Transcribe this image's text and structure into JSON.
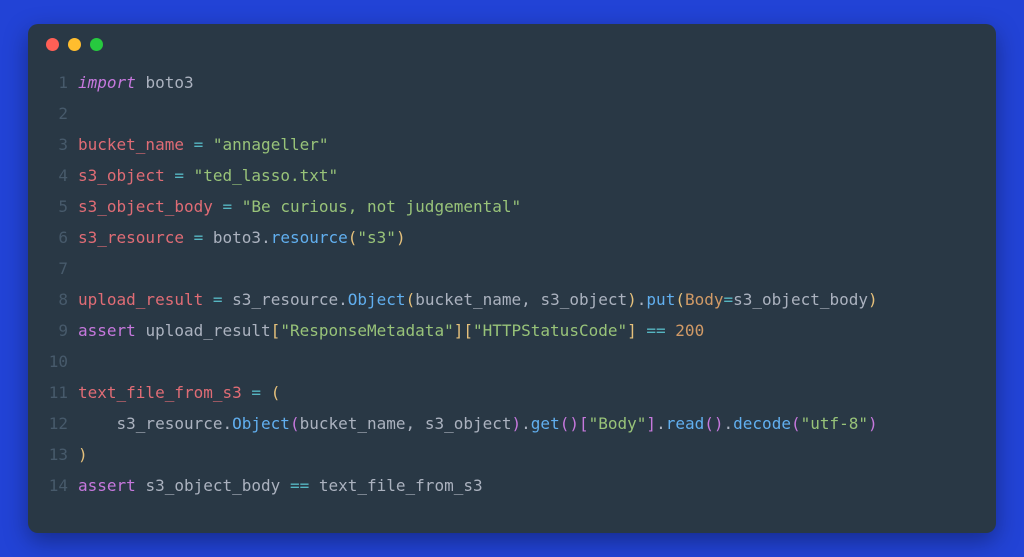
{
  "window": {
    "traffic_lights": [
      "red",
      "yellow",
      "green"
    ]
  },
  "code": {
    "line_count": 14,
    "tokens": {
      "kw_import": "import",
      "kw_assert": "assert",
      "mod_boto3": "boto3",
      "var_bucket_name": "bucket_name",
      "var_s3_object": "s3_object",
      "var_s3_object_body": "s3_object_body",
      "var_s3_resource": "s3_resource",
      "var_upload_result": "upload_result",
      "var_text_file_from_s3": "text_file_from_s3",
      "str_annageller": "\"annageller\"",
      "str_ted_lasso": "\"ted_lasso.txt\"",
      "str_body_text": "\"Be curious, not judgemental\"",
      "str_s3": "\"s3\"",
      "str_response_metadata": "\"ResponseMetadata\"",
      "str_http_status_code": "\"HTTPStatusCode\"",
      "str_body_key": "\"Body\"",
      "str_utf8": "\"utf-8\"",
      "fn_resource": "resource",
      "fn_object": "Object",
      "fn_put": "put",
      "fn_get": "get",
      "fn_read": "read",
      "fn_decode": "decode",
      "kwarg_body": "Body",
      "num_200": "200",
      "op_eq": "=",
      "op_deq": "=="
    },
    "ln": {
      "1": "1",
      "2": "2",
      "3": "3",
      "4": "4",
      "5": "5",
      "6": "6",
      "7": "7",
      "8": "8",
      "9": "9",
      "10": "10",
      "11": "11",
      "12": "12",
      "13": "13",
      "14": "14"
    }
  },
  "colors": {
    "page_bg": "#2243d6",
    "window_bg": "#293845",
    "keyword": "#c678dd",
    "variable": "#e06c75",
    "operator": "#56b6c2",
    "string": "#98c379",
    "function": "#61afef",
    "number": "#d19a66",
    "line_number": "#475a6b",
    "default_text": "#abb2bf"
  }
}
